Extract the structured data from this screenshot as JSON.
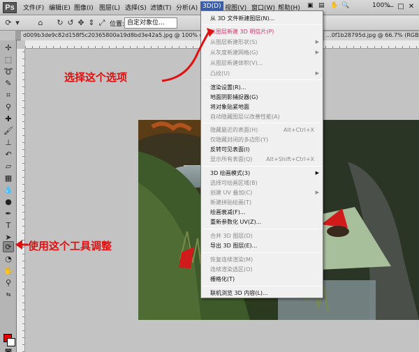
{
  "menubar": {
    "logo": "Ps",
    "items": [
      "文件(F)",
      "编辑(E)",
      "图像(I)",
      "图层(L)",
      "选择(S)",
      "滤镜(T)",
      "分析(A)",
      "3D(D)",
      "视图(V)",
      "窗口(W)",
      "帮助(H)"
    ],
    "zoom": "100%",
    "window_controls": [
      "—",
      "□",
      "✕"
    ]
  },
  "optbar": {
    "position_label": "位置:",
    "position_value": "自定对象位..."
  },
  "tabs": [
    "d009b3de9c82d158f5c20365800a19d8bd3e42a5.jpg @ 100% (图层...",
    "...0f1b28795d.jpg @ 66.7% (RGB/8#) ×"
  ],
  "dropdown": {
    "items": [
      {
        "label": "从 3D 文件新建图层(N)...",
        "shortcut": "",
        "submenu": false,
        "state": "normal"
      },
      {
        "label": "从图层新建 3D 明信片(P)",
        "shortcut": "",
        "submenu": false,
        "state": "highlight"
      },
      {
        "label": "从图层新建形状(S)",
        "shortcut": "",
        "submenu": true,
        "state": "disabled"
      },
      {
        "label": "从灰度新建网格(G)",
        "shortcut": "",
        "submenu": true,
        "state": "disabled"
      },
      {
        "label": "从图层新建体积(V)...",
        "shortcut": "",
        "submenu": false,
        "state": "disabled"
      },
      {
        "label": "凸纹(U)",
        "shortcut": "",
        "submenu": true,
        "state": "disabled"
      },
      {
        "label": "渲染设置(R)...",
        "shortcut": "",
        "submenu": false,
        "state": "normal"
      },
      {
        "label": "地面阴影捕捉器(G)",
        "shortcut": "",
        "submenu": false,
        "state": "normal"
      },
      {
        "label": "将对象贴紧地面",
        "shortcut": "",
        "submenu": false,
        "state": "normal"
      },
      {
        "label": "自动隐藏图层以改善性能(A)",
        "shortcut": "",
        "submenu": false,
        "state": "disabled"
      },
      {
        "label": "隐藏最近的表面(H)",
        "shortcut": "Alt+Ctrl+X",
        "submenu": false,
        "state": "disabled"
      },
      {
        "label": "仅隐藏封闭的多边形(Y)",
        "shortcut": "",
        "submenu": false,
        "state": "disabled"
      },
      {
        "label": "反转可见表面(I)",
        "shortcut": "",
        "submenu": false,
        "state": "normal"
      },
      {
        "label": "显示所有表面(Q)",
        "shortcut": "Alt+Shift+Ctrl+X",
        "submenu": false,
        "state": "disabled"
      },
      {
        "label": "3D 绘画模式(3)",
        "shortcut": "",
        "submenu": true,
        "state": "normal"
      },
      {
        "label": "选择可绘画区域(B)",
        "shortcut": "",
        "submenu": false,
        "state": "disabled"
      },
      {
        "label": "创建 UV 叠加(C)",
        "shortcut": "",
        "submenu": true,
        "state": "disabled"
      },
      {
        "label": "新建拼贴绘画(T)",
        "shortcut": "",
        "submenu": false,
        "state": "disabled"
      },
      {
        "label": "绘画衰减(F)...",
        "shortcut": "",
        "submenu": false,
        "state": "normal"
      },
      {
        "label": "重新参数化 UV(Z)...",
        "shortcut": "",
        "submenu": false,
        "state": "normal"
      },
      {
        "label": "合并 3D 图层(D)",
        "shortcut": "",
        "submenu": false,
        "state": "disabled"
      },
      {
        "label": "导出 3D 图层(E)...",
        "shortcut": "",
        "submenu": false,
        "state": "normal"
      },
      {
        "label": "恢复连续渲染(M)",
        "shortcut": "",
        "submenu": false,
        "state": "disabled"
      },
      {
        "label": "连续渲染选区(O)",
        "shortcut": "",
        "submenu": false,
        "state": "disabled"
      },
      {
        "label": "栅格化(T)",
        "shortcut": "",
        "submenu": false,
        "state": "normal"
      },
      {
        "label": "联机浏览 3D 内容(L)...",
        "shortcut": "",
        "submenu": false,
        "state": "normal"
      }
    ]
  },
  "annotations": {
    "select_option": "选择这个选项",
    "use_tool": "使用这个工具调整"
  },
  "colors": {
    "foreground": "#e00000",
    "background": "#ffffff",
    "annotation": "#e01010",
    "menu_highlight": "#3a5da8"
  }
}
